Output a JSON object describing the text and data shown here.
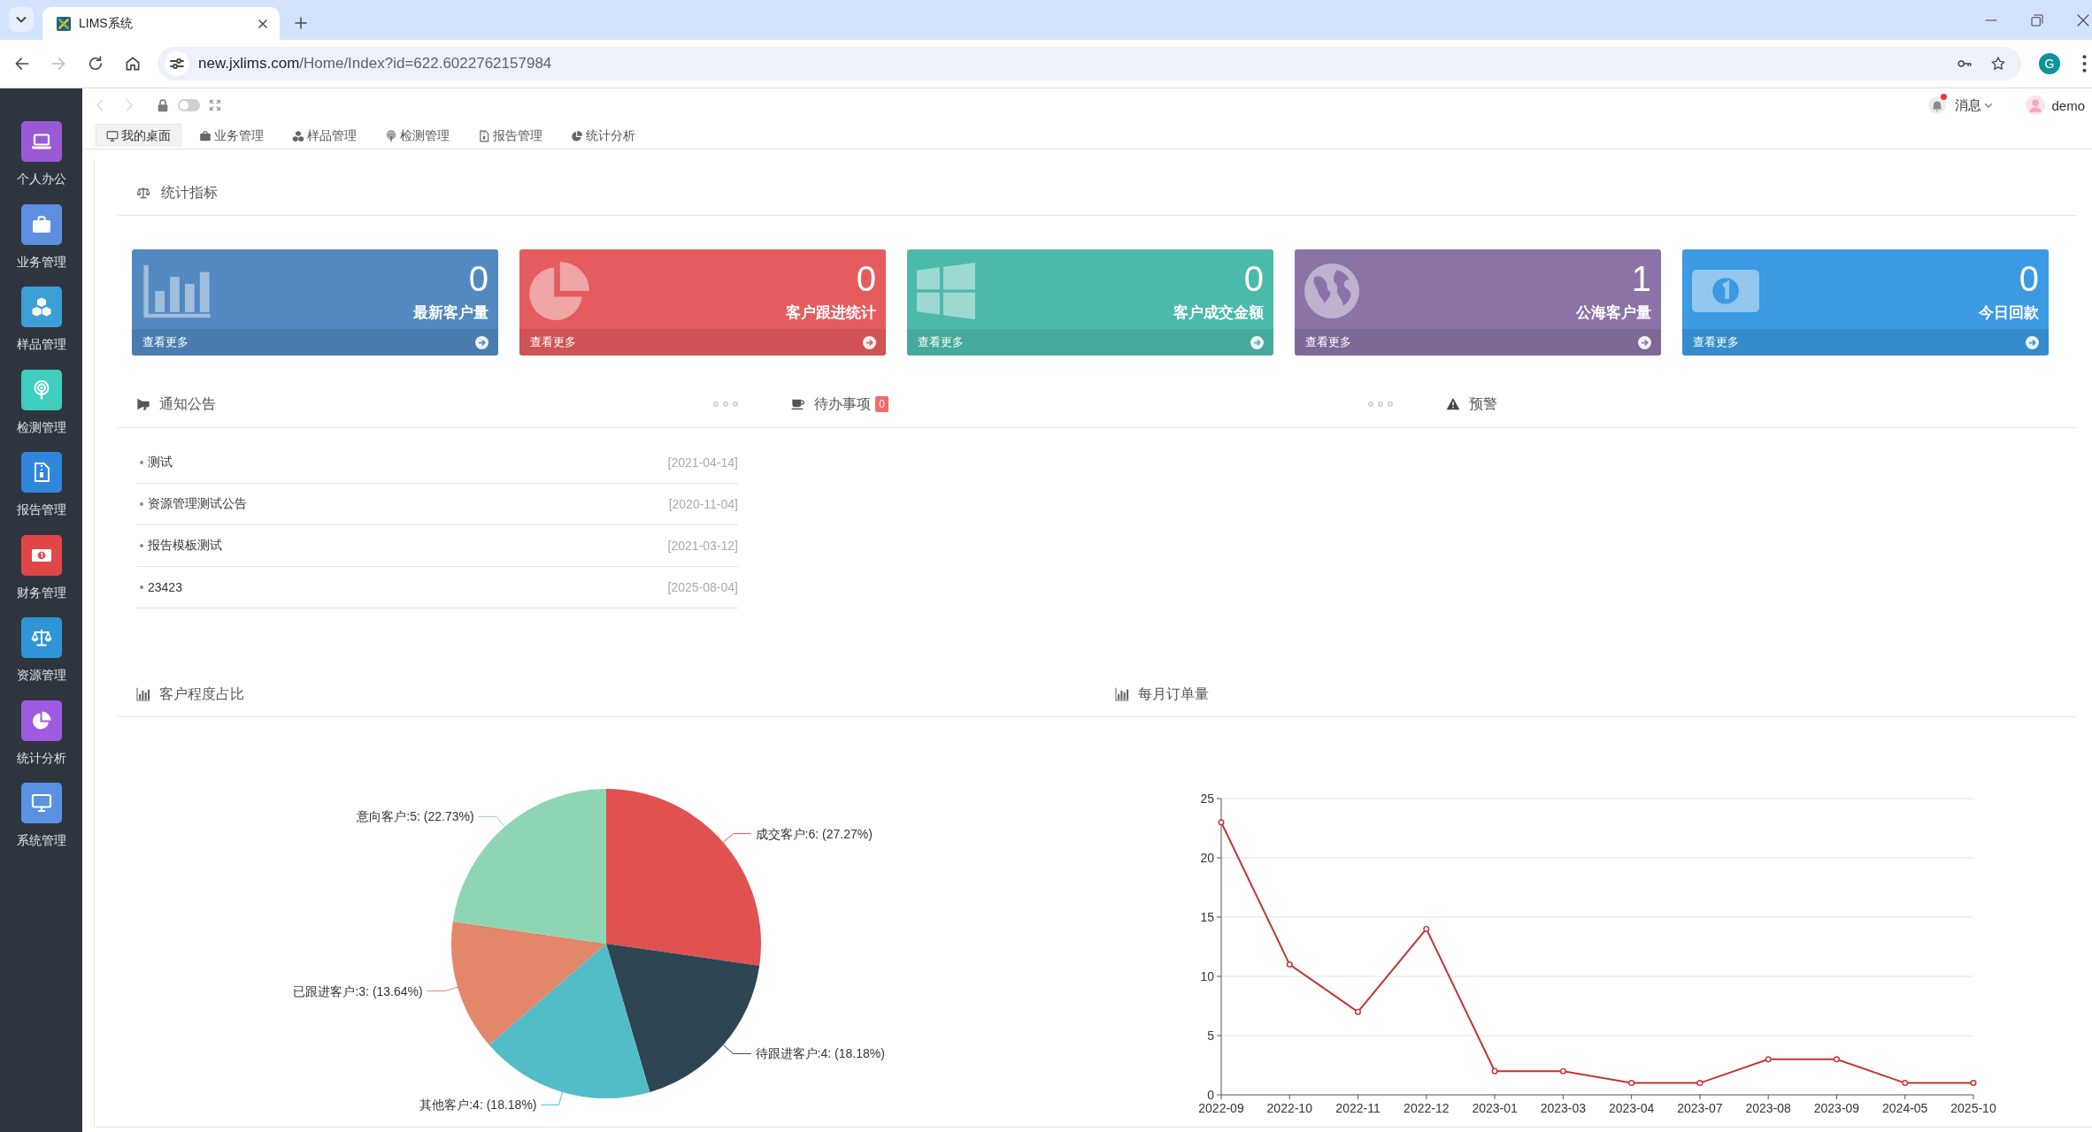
{
  "browser": {
    "tab_title": "LIMS系统",
    "url_host": "new.jxlims.com",
    "url_path": "/Home/Index?id=622.6022762157984",
    "back_disabled": false,
    "forward_disabled": true,
    "profile_initial": "G"
  },
  "sidebar": {
    "items": [
      {
        "label": "个人办公",
        "color": "#9b59d6"
      },
      {
        "label": "业务管理",
        "color": "#5d8fe0"
      },
      {
        "label": "样品管理",
        "color": "#3c9fd6"
      },
      {
        "label": "检测管理",
        "color": "#3fcdbe"
      },
      {
        "label": "报告管理",
        "color": "#2f86dc"
      },
      {
        "label": "财务管理",
        "color": "#e04646"
      },
      {
        "label": "资源管理",
        "color": "#3095d6"
      },
      {
        "label": "统计分析",
        "color": "#9f5ae2"
      },
      {
        "label": "系统管理",
        "color": "#5b91e1"
      }
    ]
  },
  "toolbar": {
    "back_disabled": true,
    "forward_disabled": true,
    "switch_on": false,
    "messages": {
      "label": "消息",
      "unread": true
    },
    "user": {
      "name": "demo"
    }
  },
  "tabs": [
    {
      "label": "我的桌面",
      "selected": true
    },
    {
      "label": "业务管理",
      "selected": false
    },
    {
      "label": "样品管理",
      "selected": false
    },
    {
      "label": "检测管理",
      "selected": false
    },
    {
      "label": "报告管理",
      "selected": false
    },
    {
      "label": "统计分析",
      "selected": false
    }
  ],
  "stats": {
    "title": "统计指标",
    "cards": [
      {
        "value": "0",
        "label": "最新客户量",
        "link": "查看更多",
        "color": "#5289c1"
      },
      {
        "value": "0",
        "label": "客户跟进统计",
        "link": "查看更多",
        "color": "#e45c5d"
      },
      {
        "value": "0",
        "label": "客户成交金额",
        "link": "查看更多",
        "color": "#4cbaab"
      },
      {
        "value": "1",
        "label": "公海客户量",
        "link": "查看更多",
        "color": "#8b73a8"
      },
      {
        "value": "0",
        "label": "今日回款",
        "link": "查看更多",
        "color": "#3b9ae1"
      }
    ]
  },
  "notices": {
    "title": "通知公告",
    "items": [
      {
        "title": "测试",
        "date": "[2021-04-14]"
      },
      {
        "title": "资源管理测试公告",
        "date": "[2020-11-04]"
      },
      {
        "title": "报告模板测试",
        "date": "[2021-03-12]"
      },
      {
        "title": "23423",
        "date": "[2025-08-04]"
      }
    ]
  },
  "todo": {
    "title": "待办事项",
    "count": "0"
  },
  "alerts": {
    "title": "预警"
  },
  "customer_share": {
    "title": "客户程度占比",
    "chart_data": {
      "type": "pie",
      "values": [
        6,
        4,
        4,
        3,
        5
      ],
      "value_labels": [
        "成交客户:6: (27.27%)",
        "待跟进客户:4: (18.18%)",
        "其他客户:4: (18.18%)",
        "已跟进客户:3: (13.64%)",
        "意向客户:5: (22.73%)"
      ]
    }
  },
  "monthly_orders": {
    "title": "每月订单量",
    "chart_data": {
      "type": "line",
      "categories": [
        "2022-09",
        "2022-10",
        "2022-11",
        "2022-12",
        "2023-01",
        "2023-03",
        "2023-04",
        "2023-07",
        "2023-08",
        "2023-09",
        "2024-05",
        "2025-10"
      ],
      "values": [
        23,
        11,
        7,
        14,
        2,
        2,
        1,
        1,
        3,
        3,
        1,
        1
      ],
      "ylim": [
        0,
        25
      ],
      "yticks": [
        0,
        5,
        10,
        15,
        20,
        25
      ],
      "grid": true,
      "marker": true
    }
  }
}
